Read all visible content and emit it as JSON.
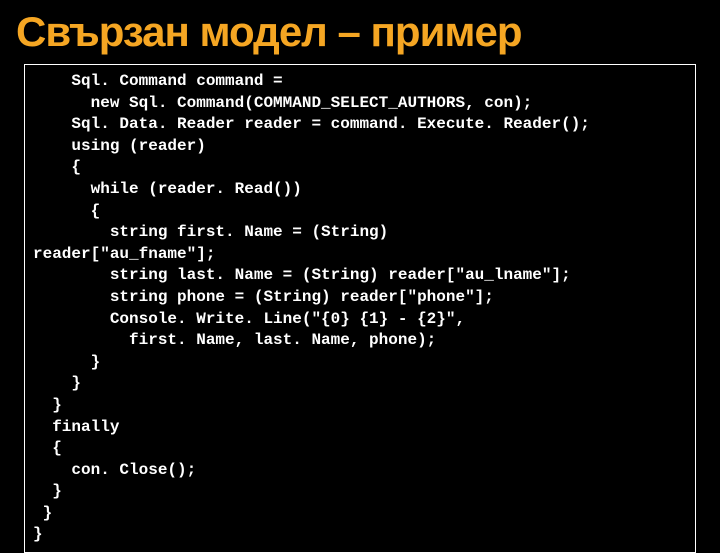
{
  "title": "Свързан модел – пример",
  "code": {
    "lines": [
      "    Sql. Command command =",
      "      new Sql. Command(COMMAND_SELECT_AUTHORS, con);",
      "    Sql. Data. Reader reader = command. Execute. Reader();",
      "    using (reader)",
      "    {",
      "      while (reader. Read())",
      "      {",
      "        string first. Name = (String)",
      "reader[\"au_fname\"];",
      "        string last. Name = (String) reader[\"au_lname\"];",
      "        string phone = (String) reader[\"phone\"];",
      "        Console. Write. Line(\"{0} {1} - {2}\",",
      "          first. Name, last. Name, phone);",
      "      }",
      "    }",
      "  }",
      "  finally",
      "  {",
      "    con. Close();",
      "  }",
      " }",
      "}"
    ]
  }
}
